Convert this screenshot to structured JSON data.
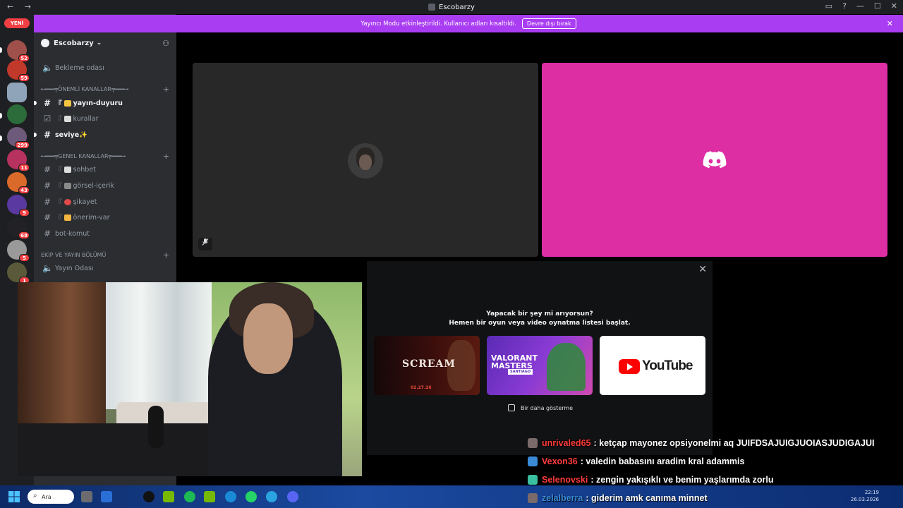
{
  "window": {
    "title": "Escobarzy",
    "nav_back": "←",
    "nav_forward": "→",
    "controls": [
      "▭",
      "?",
      "—",
      "☐",
      "✕"
    ]
  },
  "servers": {
    "new_label": "YENİ",
    "items": [
      {
        "color": "#a0504a",
        "badge": "52"
      },
      {
        "color": "#c0392b",
        "badge": "59"
      },
      {
        "color": "#8fa4b8",
        "badge": ""
      },
      {
        "color": "#2c6b3a",
        "badge": ""
      },
      {
        "color": "#6d5a7a",
        "badge": "299"
      },
      {
        "color": "#b83260",
        "badge": "11"
      },
      {
        "color": "#d96a2a",
        "badge": "43"
      },
      {
        "color": "#5a3aa0",
        "badge": "9"
      },
      {
        "color": "#222226",
        "badge": "68"
      },
      {
        "color": "#9a9a9a",
        "badge": "5"
      },
      {
        "color": "#5a5a3a",
        "badge": "1"
      }
    ]
  },
  "sidebar": {
    "server_name": "Escobarzy",
    "server_chevron": "⌄",
    "invite_icon": "person-add",
    "channels_top": [
      {
        "icon": "speaker",
        "name": "Bekleme odası"
      }
    ],
    "categories": [
      {
        "name": "╾━━━╤ÖNEMLİ KANALLAR╤━━━╼",
        "plus": "+"
      },
      {
        "name": "╾━━━╤GENEL KANALLAR╤━━━╼",
        "plus": "+"
      },
      {
        "name": "EKİP VE YAYIN BÖLÜMÜ",
        "plus": "+"
      }
    ],
    "important": [
      {
        "prefix": "『",
        "emoji_color": "#f5c542",
        "name": "yayın-duyuru",
        "unread": true
      },
      {
        "prefix": "『",
        "emoji_color": "#dcdcdc",
        "name": "kurallar",
        "unread": false
      },
      {
        "prefix": "",
        "emoji_color": "",
        "name": "seviye✨",
        "unread": true
      }
    ],
    "general": [
      {
        "prefix": "『",
        "emoji_color": "#dcdcdc",
        "name": "sohbet"
      },
      {
        "prefix": "『",
        "emoji_color": "#8a8a8a",
        "name": "görsel-içerik"
      },
      {
        "prefix": "『",
        "emoji_color": "#e04a4a",
        "name": "şikayet"
      },
      {
        "prefix": "『",
        "emoji_color": "#f5b642",
        "name": "önerim-var"
      },
      {
        "prefix": "",
        "emoji_color": "",
        "name": "bot-komut"
      }
    ],
    "team": [
      {
        "icon": "speaker",
        "name": "Yayın Odası"
      }
    ]
  },
  "banner": {
    "text": "Yayıncı Modu etkinleştirildi. Kullanıcı adları kısaltıldı.",
    "button": "Devre dışı bırak",
    "close": "✕"
  },
  "voice": {
    "mute_icon": "🎤"
  },
  "activity": {
    "close": "✕",
    "line1": "Yapacak bir şey mi arıyorsun?",
    "line2": "Hemen bir oyun veya video oynatma listesi başlat.",
    "cards": [
      {
        "title": "SCREAM",
        "subtitle": "02.27.26"
      },
      {
        "title": "VALORANT MASTERS",
        "subtitle": "SANTIAGO"
      },
      {
        "title": "YouTube",
        "subtitle": ""
      }
    ],
    "dont_show": "Bir daha gösterme"
  },
  "chat": [
    {
      "icon_color": "#7a6a6a",
      "user": "unrivaled65",
      "user_color": "#ff3b3b",
      "message": ": ketçap mayonez opsiyonelmi aq JUIFDSAJUIGJUOIASJUDIGAJUI"
    },
    {
      "icon_color": "#3a8ad6",
      "user": "Vexon36",
      "user_color": "#ff3b3b",
      "message": ": valedin babasını aradim kral adammis"
    },
    {
      "icon_color": "#3ac0a0",
      "user": "Selenovski",
      "user_color": "#ff3b3b",
      "message": ": zengin yakışıklı ve benim yaşlarımda zorlu"
    },
    {
      "icon_color": "#7a6a6a",
      "user": "zelalberra",
      "user_color": "#3a8ad6",
      "message": ": giderim amk canıma minnet"
    }
  ],
  "taskbar": {
    "search_label": "Ara",
    "time": "22:19",
    "date": "26.03.2026",
    "tray_icons": "^  ☁  ▭  🔊"
  }
}
